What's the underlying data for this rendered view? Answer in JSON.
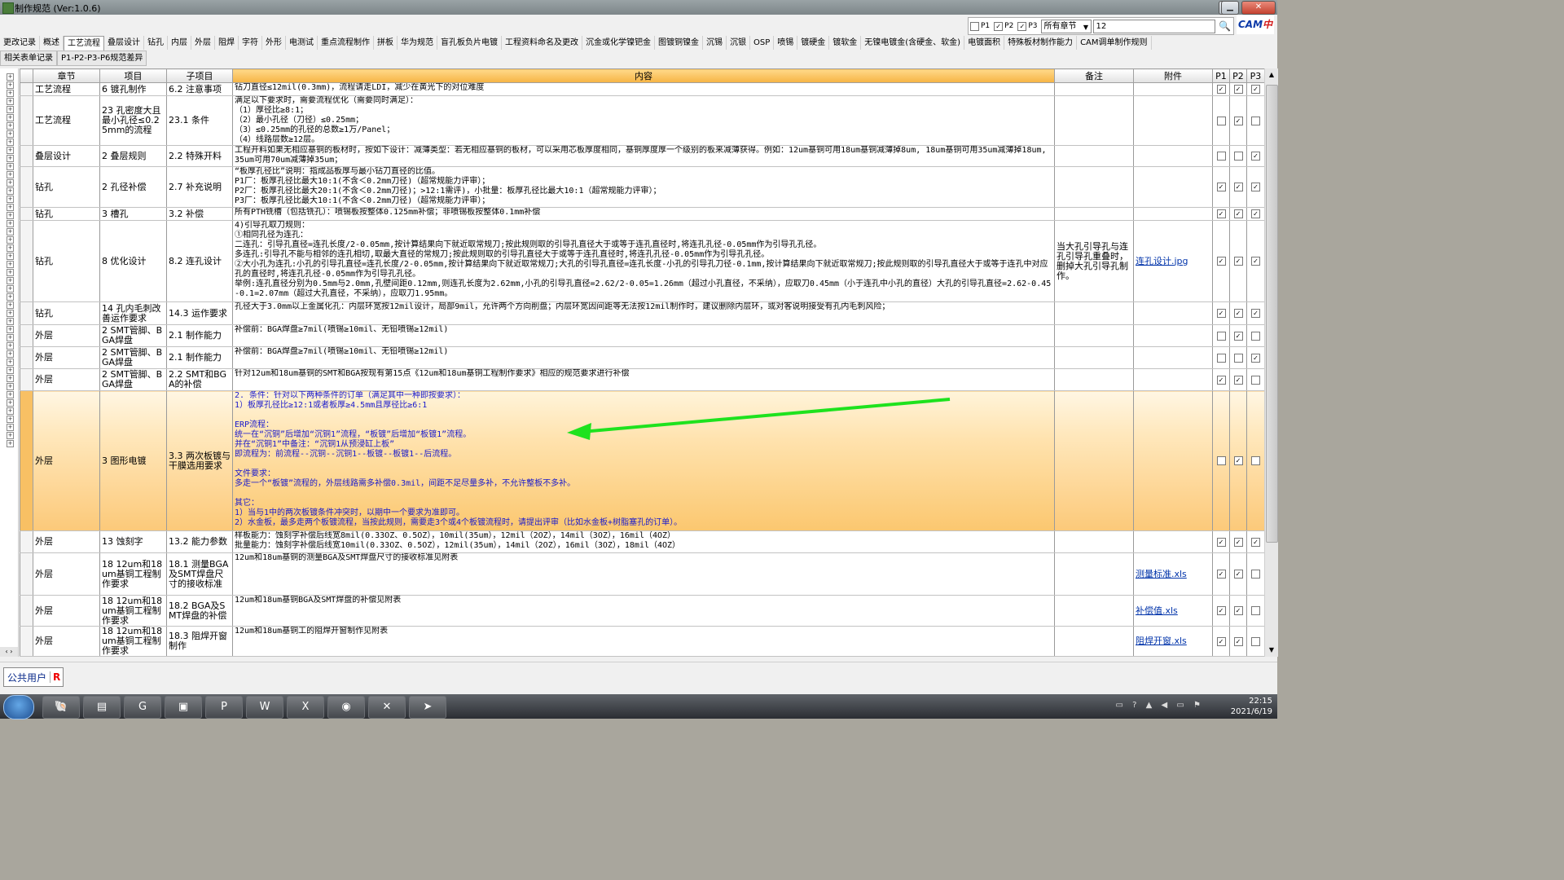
{
  "window": {
    "title": "制作规范 (Ver:1.0.6)"
  },
  "filters": {
    "p1": {
      "label": "P1",
      "checked": false
    },
    "p2": {
      "label": "P2",
      "checked": true
    },
    "p3": {
      "label": "P3",
      "checked": true
    },
    "chapter_select": "所有章节",
    "search_value": "12",
    "logo_a": "CAM",
    "logo_b": "中心"
  },
  "tabs_row1": [
    "更改记录",
    "概述",
    "工艺流程",
    "叠层设计",
    "钻孔",
    "内层",
    "外层",
    "阻焊",
    "字符",
    "外形",
    "电测试",
    "重点流程制作",
    "拼板",
    "华为规范",
    "盲孔板负片电镀",
    "工程资料命名及更改",
    "沉金或化学镍钯金",
    "图镀铜镍金",
    "沉锡",
    "沉银",
    "OSP",
    "喷锡",
    "镀硬金",
    "镀软金",
    "无镍电镀金(含硬金、软金)",
    "电镀面积",
    "特殊板材制作能力",
    "CAM调单制作规则"
  ],
  "active_tab": "工艺流程",
  "tabs_row2": [
    "相关表单记录",
    "P1-P2-P3-P6规范差异"
  ],
  "columns": {
    "chapter": "章节",
    "item": "项目",
    "subitem": "子项目",
    "content": "内容",
    "remark": "备注",
    "attachment": "附件",
    "p1": "P1",
    "p2": "P2",
    "p3": "P3"
  },
  "rows": [
    {
      "chapter": "工艺流程",
      "item": "6 镀孔制作",
      "subitem": "6.2 注意事项",
      "content": "钻刀直径≤12mil(0.3mm)，流程请走LDI，减少在黄光下的对位难度",
      "remark": "",
      "attachment": "",
      "p1": true,
      "p2": true,
      "p3": true
    },
    {
      "chapter": "工艺流程",
      "item": "23 孔密度大且最小孔径≤0.25mm的流程",
      "subitem": "23.1 条件",
      "content": "满足以下要求时，需要流程优化（需要同时满足）：\n（1）厚径比≥8:1；\n（2）最小孔径（刀径）≤0.25mm；\n（3）≤0.25mm的孔径的总数≥1万/Panel；\n（4）线路层数≥12层。",
      "remark": "",
      "attachment": "",
      "p1": false,
      "p2": true,
      "p3": false
    },
    {
      "chapter": "叠层设计",
      "item": "2 叠层规则",
      "subitem": "2.2 特殊开料",
      "content": "工程开料如果无相应基铜的板材时，按如下设计：减薄类型：若无相应基铜的板材，可以采用芯板厚度相同，基铜厚度厚一个级别的板来减薄获得。例如：12um基铜可用18um基铜减薄掉8um, 18um基铜可用35um减薄掉18um, 35um可用70um减薄掉35um；",
      "remark": "",
      "attachment": "",
      "p1": false,
      "p2": false,
      "p3": true
    },
    {
      "chapter": "钻孔",
      "item": "2 孔径补偿",
      "subitem": "2.7 补充说明",
      "content": "“板厚孔径比”说明：指成品板厚与最小钻刀直径的比值。\nP1厂：板厚孔径比最大10:1(不含＜0.2mm刀径)（超常规能力评审）；\nP2厂：板厚孔径比最大20:1(不含＜0.2mm刀径)；>12:1需评)，小批量：板厚孔径比最大10:1（超常规能力评审）；\nP3厂：板厚孔径比最大10:1(不含＜0.2mm刀径)（超常规能力评审）；",
      "remark": "",
      "attachment": "",
      "p1": true,
      "p2": true,
      "p3": true
    },
    {
      "chapter": "钻孔",
      "item": "3 槽孔",
      "subitem": "3.2 补偿",
      "content": "所有PTH铣槽（包括铣孔）：喷锡板按整体0.125mm补偿；非喷锡板按整体0.1mm补偿",
      "remark": "",
      "attachment": "",
      "p1": true,
      "p2": true,
      "p3": true
    },
    {
      "chapter": "钻孔",
      "item": "8 优化设计",
      "subitem": "8.2 连孔设计",
      "content": "4)引导孔取刀规则：\n①相同孔径为连孔：\n二连孔：引导孔直径=连孔长度/2-0.05mm,按计算结果向下就近取常规刀;按此规则取的引导孔直径大于或等于连孔直径时,将连孔孔径-0.05mm作为引导孔孔径。\n多连孔:引导孔不能与相邻的连孔相切,取最大直径的常规刀;按此规则取的引导孔直径大于或等于连孔直径时,将连孔孔径-0.05mm作为引导孔孔径。\n②大小孔为连孔:小孔的引导孔直径=连孔长度/2-0.05mm,按计算结果向下就近取常规刀;大孔的引导孔直径=连孔长度-小孔的引导孔刀径-0.1mm,按计算结果向下就近取常规刀;按此规则取的引导孔直径大于或等于连孔中对应孔的直径时,将连孔孔径-0.05mm作为引导孔孔径。\n举例:连孔直径分别为0.5mm与2.0mm,孔壁间距0.12mm,则连孔长度为2.62mm,小孔的引导孔直径=2.62/2-0.05=1.26mm（超过小孔直径，不采纳），应取刀0.45mm（小于连孔中小孔的直径）大孔的引导孔直径=2.62-0.45-0.1=2.07mm（超过大孔直径，不采纳），应取刀1.95mm。",
      "remark": "当大孔引导孔与连孔引导孔重叠时，删掉大孔引导孔制作。",
      "attachment": "连孔设计.jpg",
      "p1": true,
      "p2": true,
      "p3": true
    },
    {
      "chapter": "钻孔",
      "item": "14 孔内毛刺改善运作要求",
      "subitem": "14.3 运作要求",
      "content": "孔径大于3.0mm以上金属化孔：内层环宽按12mil设计，局部9mil，允许两个方向削盘；内层环宽因间距等无法按12mil制作时，建议删除内层环，或对客说明接受有孔内毛刺风险；",
      "remark": "",
      "attachment": "",
      "p1": true,
      "p2": true,
      "p3": true
    },
    {
      "chapter": "外层",
      "item": "2 SMT管脚、BGA焊盘",
      "subitem": "2.1 制作能力",
      "content": "补偿前：BGA焊盘≥7mil(喷锡≥10mil、无铅喷锡≥12mil)",
      "remark": "",
      "attachment": "",
      "p1": false,
      "p2": true,
      "p3": false
    },
    {
      "chapter": "外层",
      "item": "2 SMT管脚、BGA焊盘",
      "subitem": "2.1 制作能力",
      "content": "补偿前：BGA焊盘≥7mil(喷锡≥10mil、无铅喷锡≥12mil)",
      "remark": "",
      "attachment": "",
      "p1": false,
      "p2": false,
      "p3": true
    },
    {
      "chapter": "外层",
      "item": "2 SMT管脚、BGA焊盘",
      "subitem": "2.2 SMT和BGA的补偿",
      "content": "针对12um和18um基铜的SMT和BGA按现有第15点《12um和18um基铜工程制作要求》相应的规范要求进行补偿",
      "remark": "",
      "attachment": "",
      "p1": true,
      "p2": true,
      "p3": false
    },
    {
      "chapter": "外层",
      "item": "3 图形电镀",
      "subitem": "3.3 两次板镀与干膜选用要求",
      "content": "2. 条件：针对以下两种条件的订单（满足其中一种即按要求）：\n1）板厚孔径比≥12:1或者板厚≥4.5mm且厚径比≥6:1\n\nERP流程：\n统一在“沉铜”后增加“沉铜1”流程，“板镀”后增加“板镀1”流程。\n并在“沉铜1”中备注：“沉铜1从预浸缸上板”\n即流程为：前流程--沉铜--沉铜1--板镀--板镀1--后流程。\n\n文件要求：\n多走一个“板镀”流程的，外层线路需多补偿0.3mil，间距不足尽量多补，不允许整板不多补。\n\n其它：\n1）当与1中的两次板镀条件冲突时，以期中一个要求为准即可。\n2）水金板，最多走两个板镀流程，当按此规则，需要走3个或4个板镀流程时，请提出评审（比如水金板+树脂塞孔的订单）。",
      "remark": "",
      "attachment": "",
      "p1": false,
      "p2": true,
      "p3": false,
      "highlight": true
    },
    {
      "chapter": "外层",
      "item": "13 蚀刻字",
      "subitem": "13.2 能力参数",
      "content": "样板能力：蚀刻字补偿后线宽8mil(0.33OZ、0.5OZ），10mil(35um），12mil（2OZ），14mil（3OZ），16mil（4OZ）\n批量能力：蚀刻字补偿后线宽10mil(0.33OZ、0.5OZ），12mil(35um），14mil（2OZ），16mil（3OZ），18mil（4OZ）",
      "remark": "",
      "attachment": "",
      "p1": true,
      "p2": true,
      "p3": true
    },
    {
      "chapter": "外层",
      "item": "18 12um和18um基铜工程制作要求",
      "subitem": "18.1 测量BGA及SMT焊盘尺寸的接收标准",
      "content": "12um和18um基铜的测量BGA及SMT焊盘尺寸的接收标准见附表",
      "remark": "",
      "attachment": "测量标准.xls",
      "p1": true,
      "p2": true,
      "p3": false
    },
    {
      "chapter": "外层",
      "item": "18 12um和18um基铜工程制作要求",
      "subitem": "18.2 BGA及SMT焊盘的补偿",
      "content": "12um和18um基铜BGA及SMT焊盘的补偿见附表",
      "remark": "",
      "attachment": "补偿值.xls",
      "p1": true,
      "p2": true,
      "p3": false
    },
    {
      "chapter": "外层",
      "item": "18 12um和18um基铜工程制作要求",
      "subitem": "18.3 阻焊开窗制作",
      "content": "12um和18um基铜工的阻焊开窗制作见附表",
      "remark": "",
      "attachment": "阻焊开窗.xls",
      "p1": true,
      "p2": true,
      "p3": false
    }
  ],
  "status": {
    "user": "公共用户",
    "flag": "R"
  },
  "taskbar": {
    "time": "22:15",
    "date": "2021/6/19"
  }
}
